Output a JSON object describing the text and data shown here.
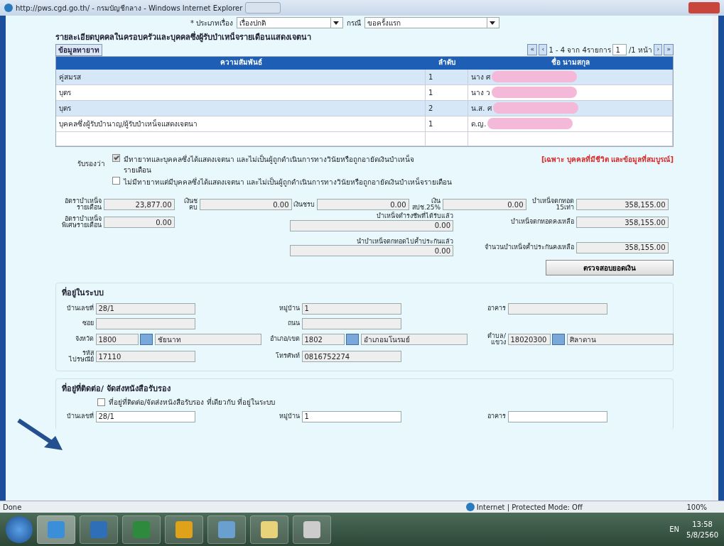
{
  "window": {
    "title": "http://pws.cgd.go.th/ - กรมบัญชีกลาง - Windows Internet Explorer"
  },
  "filters": [
    {
      "label": "* ประเภทเรื่อง",
      "value": "เรื่องปกติ"
    },
    {
      "label": "กรณี",
      "value": "ขอครั้งแรก"
    }
  ],
  "family": {
    "title": "รายละเอียดบุคคลในครอบครัวและบุคคลซึ่งผู้รับบำเหน็จรายเดือนแสดงเจตนา",
    "tab_button": "ข้อมูลทายาท",
    "pager": {
      "first": "«",
      "prev": "‹",
      "range": "1 - 4 จาก 4รายการ",
      "page": "1",
      "of": "/1 หน้า",
      "next": "›",
      "last": "»"
    },
    "columns": [
      "ความสัมพันธ์",
      "ลำดับ",
      "ชื่อ นามสกุล"
    ],
    "rows": [
      {
        "relation": "คู่สมรส",
        "order": "1",
        "name": "นาง ศ"
      },
      {
        "relation": "บุตร",
        "order": "1",
        "name": "นาง ว"
      },
      {
        "relation": "บุตร",
        "order": "2",
        "name": "น.ส. ศ"
      },
      {
        "relation": "บุคคลซึ่งผู้รับบำนาญ/ผู้รับบำเหน็จแสดงเจตนา",
        "order": "1",
        "name": "ด.ญ."
      }
    ]
  },
  "certify": {
    "label": "รับรองว่า",
    "note": "[เฉพาะ บุคคลที่มีชีวิต และข้อมูลที่สมบูรณ์]",
    "options": [
      {
        "text": "มีทายาทและบุคคลซึ่งได้แสดงเจตนา และไม่เป็นผู้ถูกดำเนินการทางวินัยหรือถูกอายัดเงินบำเหน็จรายเดือน",
        "checked": true,
        "disabled": true
      },
      {
        "text": "ไม่มีทายาทแต่มีบุคคลซึ่งได้แสดงเจตนา และไม่เป็นผู้ถูกดำเนินการทางวินัยหรือถูกอายัดเงินบำเหน็จรายเดือน",
        "checked": false,
        "disabled": false
      }
    ]
  },
  "amounts": {
    "row1": [
      {
        "label": "อัตราบำเหน็จรายเดือน",
        "value": "23,877.00"
      },
      {
        "label": "เงินชคบ",
        "value": "0.00"
      },
      {
        "label": "เงินชรบ",
        "value": "0.00"
      },
      {
        "label": "เงิน สปช.25%",
        "value": "0.00"
      },
      {
        "label": "บำเหน็จตกทอด 15เท่า",
        "value": "358,155.00"
      }
    ],
    "special": {
      "label": "อัตราบำเหน็จพิเศษรายเดือน",
      "value": "0.00"
    },
    "middle": [
      {
        "label": "บำเหน็จดำรงชีพที่ได้รับแล้ว",
        "value": "0.00"
      },
      {
        "label": "นำบำเหน็จตกทอดไปค้ำประกันแล้ว",
        "value": "0.00"
      }
    ],
    "right": [
      {
        "label": "บำเหน็จตกทอดคงเหลือ",
        "value": "358,155.00"
      },
      {
        "label": "จำนวนบำเหน็จค้ำประกันคงเหลือ",
        "value": "358,155.00"
      }
    ],
    "check_button": "ตรวจสอบยอดเงิน"
  },
  "address": {
    "title": "ที่อยู่ในระบบ",
    "rows": [
      [
        {
          "kind": "text",
          "label": "บ้านเลขที่",
          "value": "28/1"
        },
        {
          "kind": "text",
          "label": "หมู่บ้าน",
          "value": "1"
        },
        {
          "kind": "text",
          "label": "อาคาร"
        }
      ],
      [
        {
          "kind": "text",
          "label": "ซอย"
        },
        {
          "kind": "text",
          "label": "ถนน"
        }
      ],
      [
        {
          "kind": "lookup",
          "label": "จังหวัด",
          "code": "1800",
          "value": "ชัยนาท"
        },
        {
          "kind": "lookup",
          "label": "อำเภอ/เขต",
          "code": "1802",
          "value": "อำเภอมโนรมย์"
        },
        {
          "kind": "lookup",
          "label": "ตำบล/แขวง",
          "code": "18020300",
          "value": "ศิลาดาน"
        }
      ],
      [
        {
          "kind": "text",
          "label": "รหัสไปรษณีย์",
          "value": "17110"
        },
        {
          "kind": "text",
          "label": "โทรศัพท์",
          "value": "0816752274"
        }
      ]
    ]
  },
  "contact": {
    "title": "ที่อยู่ที่ติดต่อ/ จัดส่งหนังสือรับรอง",
    "same_as": {
      "text": "ที่อยู่ที่ติดต่อ/จัดส่งหนังสือรับรอง ที่เดียวกับ ที่อยู่ในระบบ",
      "checked": false
    },
    "rows": [
      [
        {
          "kind": "text",
          "label": "บ้านเลขที่",
          "value": "28/1"
        },
        {
          "kind": "text",
          "label": "หมู่บ้าน",
          "value": "1"
        },
        {
          "kind": "text",
          "label": "อาคาร"
        }
      ]
    ]
  },
  "status_bar": {
    "text": "Done",
    "zone": "Internet | Protected Mode: Off",
    "zoom": "100%"
  },
  "taskbar": {
    "apps": [
      {
        "selected": true
      },
      {
        "selected": false
      },
      {
        "selected": false
      },
      {
        "selected": false
      },
      {
        "selected": false
      },
      {
        "selected": false
      },
      {
        "selected": false
      }
    ],
    "lang": "EN",
    "time": "13:58",
    "date": "5/8/2560"
  }
}
